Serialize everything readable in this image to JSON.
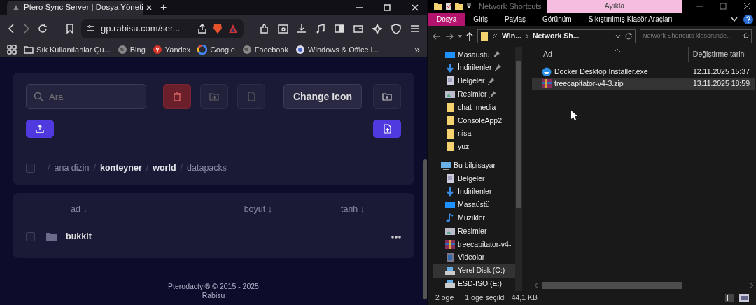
{
  "browser": {
    "tab": {
      "title": "Ptero Sync Server | Dosya Yöneti",
      "selected": true
    },
    "new_tab": "+",
    "address": "gp.rabisu.com/ser...",
    "bookmarks": [
      {
        "label": "Sık Kullanılanlar Çu...",
        "kind": "folder"
      },
      {
        "label": "Bing",
        "kind": "globe"
      },
      {
        "label": "Yandex",
        "kind": "yandex"
      },
      {
        "label": "Google",
        "kind": "google"
      },
      {
        "label": "Facebook",
        "kind": "globe"
      },
      {
        "label": "Windows & Office i...",
        "kind": "disc"
      }
    ],
    "bookmarks_more": "»",
    "page": {
      "search": {
        "placeholder": "Ara"
      },
      "change_icon": "Change Icon",
      "breadcrumb": [
        {
          "sep": "/",
          "label": "ana dizin",
          "bold": false
        },
        {
          "sep": "/",
          "label": "konteyner",
          "bold": true
        },
        {
          "sep": "/",
          "label": "world",
          "bold": true
        },
        {
          "sep": "/",
          "label": "datapacks",
          "bold": false
        }
      ],
      "select_all": {
        "checked": false
      },
      "columns": [
        "ad ↓",
        "boyut ↓",
        "tarih ↓"
      ],
      "rows": [
        {
          "name": "bukkit",
          "checked": false
        }
      ],
      "footer": [
        "Pterodactyl® © 2015 - 2025",
        "Rabisu"
      ]
    }
  },
  "explorer": {
    "title": "Network Shortcuts",
    "context_tab": "Ayıkla",
    "ribbon_tabs": [
      {
        "label": "Dosya",
        "selected": true
      },
      {
        "label": "Giriş",
        "selected": false
      },
      {
        "label": "Paylaş",
        "selected": false
      },
      {
        "label": "Görünüm",
        "selected": false
      },
      {
        "label": "Sıkıştırılmış Klasör Araçları",
        "selected": false
      }
    ],
    "path": [
      "Win...",
      "Network Sh..."
    ],
    "search": {
      "placeholder": "Network Shortcuts klasöründe..."
    },
    "nav": [
      {
        "label": "Masaüstü",
        "kind": "desktop",
        "pinned": true,
        "selected": false
      },
      {
        "label": "İndirilenler",
        "kind": "download",
        "pinned": true,
        "selected": false
      },
      {
        "label": "Belgeler",
        "kind": "doc",
        "pinned": true,
        "selected": false
      },
      {
        "label": "Resimler",
        "kind": "pictures",
        "pinned": true,
        "selected": false
      },
      {
        "label": "chat_media",
        "kind": "folder",
        "pinned": false,
        "selected": false
      },
      {
        "label": "ConsoleApp2",
        "kind": "folder",
        "pinned": false,
        "selected": false
      },
      {
        "label": "nisa",
        "kind": "folder",
        "pinned": false,
        "selected": false
      },
      {
        "label": "yuz",
        "kind": "folder",
        "pinned": false,
        "selected": false
      },
      {
        "label": "Bu bilgisayar",
        "kind": "pc",
        "pinned": false,
        "selected": false,
        "children": [
          {
            "label": "Belgeler",
            "kind": "doc",
            "pinned": false,
            "selected": false
          },
          {
            "label": "İndirilenler",
            "kind": "download",
            "pinned": false,
            "selected": false
          },
          {
            "label": "Masaüstü",
            "kind": "desktop",
            "pinned": false,
            "selected": false
          },
          {
            "label": "Müzikler",
            "kind": "music",
            "pinned": false,
            "selected": false
          },
          {
            "label": "Resimler",
            "kind": "pictures",
            "pinned": false,
            "selected": false
          },
          {
            "label": "treecapitator-v4-",
            "kind": "archive",
            "pinned": false,
            "selected": false
          },
          {
            "label": "Videolar",
            "kind": "video",
            "pinned": false,
            "selected": false
          },
          {
            "label": "Yerel Disk (C:)",
            "kind": "drive",
            "pinned": false,
            "selected": true
          },
          {
            "label": "ESD-ISO (E:)",
            "kind": "drive",
            "pinned": false,
            "selected": false
          }
        ]
      }
    ],
    "columns": [
      "Ad",
      "Değiştirme tarihi"
    ],
    "files": [
      {
        "name": "Docker Desktop Installer.exe",
        "date": "12.11.2025 15:37",
        "kind": "installer",
        "selected": false
      },
      {
        "name": "treecapitator-v4-3.zip",
        "date": "13.11.2025 18:59",
        "kind": "archive",
        "selected": true
      }
    ],
    "status": [
      "2 öğe",
      "1 öğe seçildi",
      "44,1 KB"
    ]
  }
}
